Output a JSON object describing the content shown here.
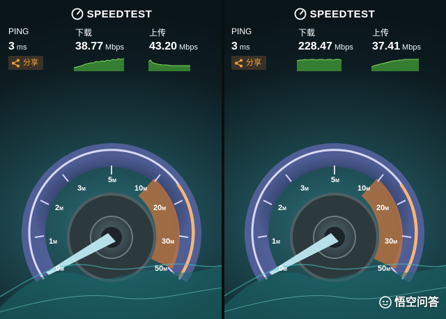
{
  "brand": "SPEEDTEST",
  "colors": {
    "spark": "#5fbf4a",
    "accent": "#f2a23a",
    "needle": "#bfe8f0"
  },
  "gauge_labels": [
    "0",
    "1",
    "2",
    "3",
    "5",
    "10",
    "20",
    "30",
    "50"
  ],
  "gauge_unit": "M",
  "panels": [
    {
      "ping_label": "PING",
      "ping_value": "3",
      "ping_unit": "ms",
      "download_label": "下载",
      "download_value": "38.77",
      "download_unit": "Mbps",
      "upload_label": "上传",
      "upload_value": "43.20",
      "upload_unit": "Mbps",
      "share_label": "分享"
    },
    {
      "ping_label": "PING",
      "ping_value": "3",
      "ping_unit": "ms",
      "download_label": "下载",
      "download_value": "228.47",
      "download_unit": "Mbps",
      "upload_label": "上传",
      "upload_value": "37.41",
      "upload_unit": "Mbps",
      "share_label": "分享"
    }
  ],
  "watermark": "悟空问答"
}
